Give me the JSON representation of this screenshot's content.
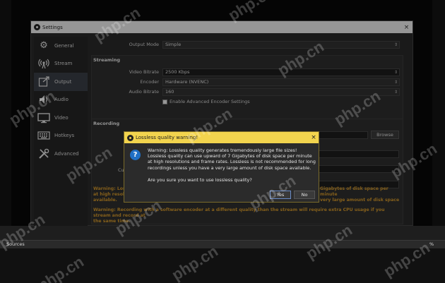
{
  "settings_window": {
    "title": "Settings",
    "close_glyph": "×"
  },
  "sidebar": {
    "items": [
      {
        "label": "General",
        "icon": "gear-icon"
      },
      {
        "label": "Stream",
        "icon": "broadcast-icon"
      },
      {
        "label": "Output",
        "icon": "output-icon"
      },
      {
        "label": "Audio",
        "icon": "speaker-icon"
      },
      {
        "label": "Video",
        "icon": "monitor-icon"
      },
      {
        "label": "Hotkeys",
        "icon": "keyboard-icon"
      },
      {
        "label": "Advanced",
        "icon": "tools-icon"
      }
    ],
    "active": "Output"
  },
  "output": {
    "mode_label": "Output Mode",
    "mode_value": "Simple"
  },
  "streaming": {
    "title": "Streaming",
    "video_bitrate_label": "Video Bitrate",
    "video_bitrate_value": "2500 Kbps",
    "encoder_label": "Encoder",
    "encoder_value": "Hardware (NVENC)",
    "audio_bitrate_label": "Audio Bitrate",
    "audio_bitrate_value": "160",
    "advanced_encoder_label": "Enable Advanced Encoder Settings"
  },
  "recording": {
    "title": "Recording",
    "browse_label": "Browse",
    "custom_label_partial": "Cus",
    "warning_1_left": "Warning: Loss",
    "warning_1_left_line2": "at high resolu",
    "warning_1_left_line3": "available.",
    "warning_1_right": "Gigabytes of disk space per minute",
    "warning_1_right_line2": "very large amount of disk space",
    "warning_2": "Warning: Recording with a software encoder at a different quality than the stream will require extra CPU usage if you stream and record at",
    "warning_2_line2": "the same time."
  },
  "dialog": {
    "title": "Lossless quality warning!",
    "close_glyph": "×",
    "message": "Warning: Lossless quality generates tremendously large file sizes! Lossless quality can use upward of 7 Gigabytes of disk space per minute at high resolutions and frame rates. Lossless is not recommended for long recordings unless you have a very large amount of disk space available.",
    "question": "Are you sure you want to use lossless quality?",
    "yes_label": "Yes",
    "no_label": "No"
  },
  "background": {
    "sources_label": "Sources",
    "percent_label": "%"
  },
  "watermark_text": "php.cn",
  "colors": {
    "warning_text": "#d69a2d",
    "dialog_titlebar": "#f2d44e",
    "active_sidebar": "#3b3f47"
  }
}
